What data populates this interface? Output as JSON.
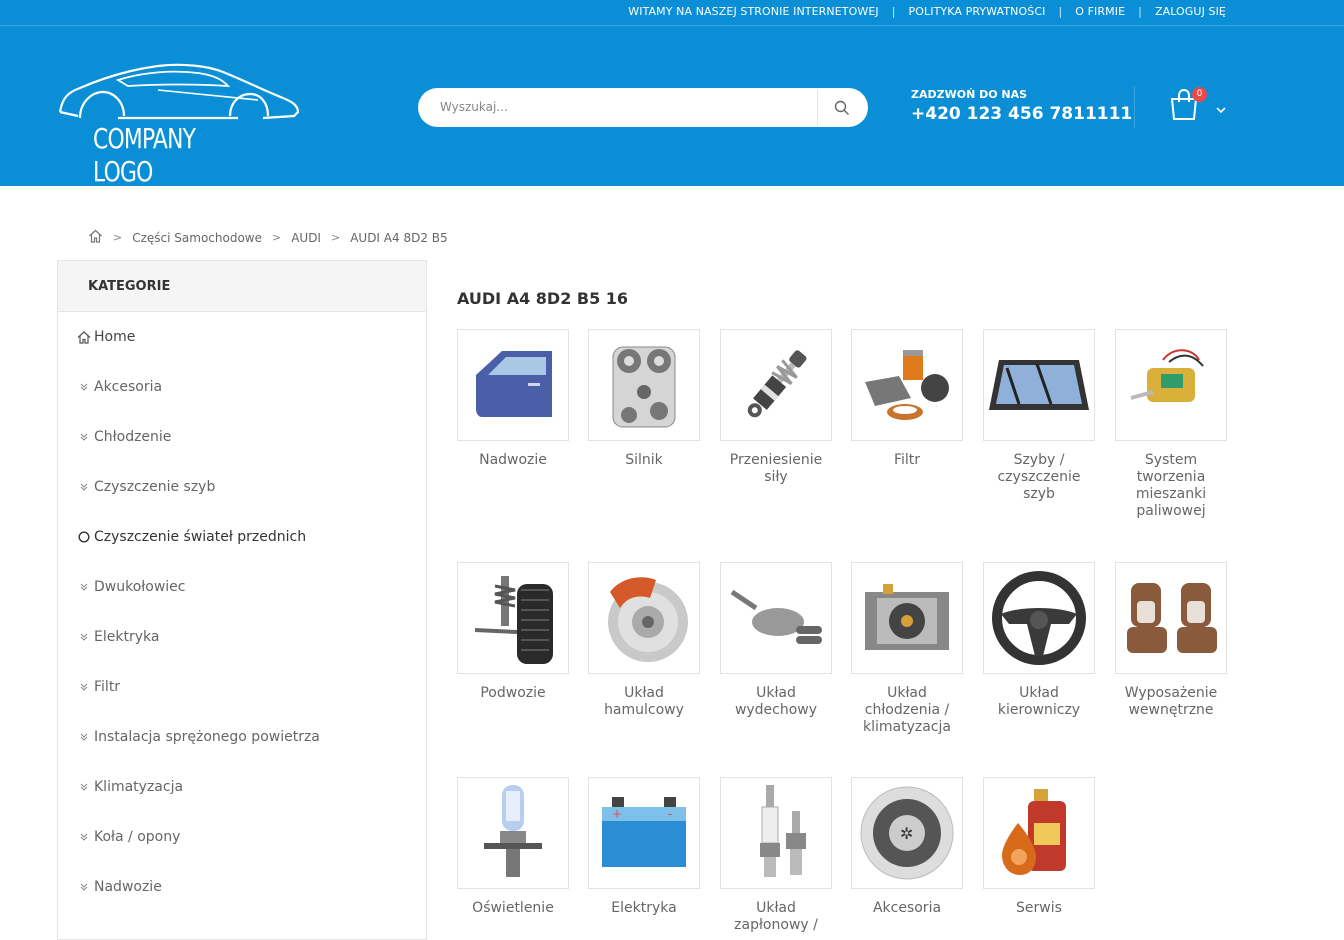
{
  "topbar": {
    "links": [
      "WITAMY NA NASZEJ STRONIE INTERNETOWEJ",
      "POLITYKA PRYWATNOŚCI",
      "O FIRMIE",
      "ZALOGUJ SIĘ"
    ]
  },
  "logo": {
    "text": "COMPANY LOGO"
  },
  "search": {
    "placeholder": "Wyszukaj..."
  },
  "contact": {
    "label": "ZADZWOŃ DO NAS",
    "phone": "+420 123 456 7811111"
  },
  "cart": {
    "count": "0"
  },
  "breadcrumb": [
    "Części Samochodowe",
    "AUDI",
    "AUDI A4 8D2 B5"
  ],
  "sidebar": {
    "title": "KATEGORIE",
    "items": [
      "Home",
      "Akcesoria",
      "Chłodzenie",
      "Czyszczenie szyb",
      "Czyszczenie świateł przednich",
      "Dwukołowiec",
      "Elektryka",
      "Filtr",
      "Instalacja sprężonego powietrza",
      "Klimatyzacja",
      "Koła / opony",
      "Nadwozie"
    ]
  },
  "main": {
    "title": "AUDI A4 8D2 B5 16",
    "categories": [
      "Nadwozie",
      "Silnik",
      "Przeniesienie siły",
      "Filtr",
      "Szyby / czyszczenie szyb",
      "System tworzenia mieszanki paliwowej",
      "Podwozie",
      "Układ hamulcowy",
      "Układ wydechowy",
      "Układ chłodzenia / klimatyzacja",
      "Układ kierowniczy",
      "Wyposażenie wewnętrzne",
      "Oświetlenie",
      "Elektryka",
      "Układ zapłonowy /",
      "Akcesoria",
      "Serwis"
    ]
  }
}
